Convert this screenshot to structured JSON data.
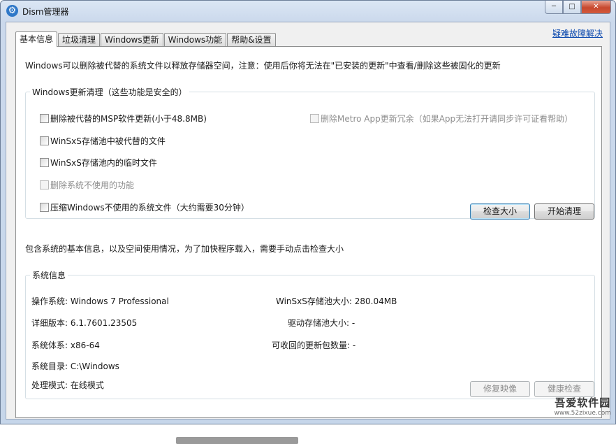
{
  "window": {
    "title": "Dism管理器",
    "buttons": {
      "minimize": "─",
      "maximize": "□",
      "close": "✕"
    }
  },
  "tabs": [
    {
      "label": "基本信息",
      "active": true
    },
    {
      "label": "垃圾清理",
      "active": false
    },
    {
      "label": "Windows更新",
      "active": false
    },
    {
      "label": "Windows功能",
      "active": false
    },
    {
      "label": "帮助&设置",
      "active": false
    }
  ],
  "help_link": "疑难故障解决",
  "notice": "Windows可以删除被代替的系统文件以释放存储器空间，注意：使用后你将无法在\"已安装的更新\"中查看/删除这些被固化的更新",
  "update_cleanup": {
    "title": "Windows更新清理（这些功能是安全的）",
    "options": [
      {
        "label": "删除被代替的MSP软件更新(小于48.8MB)",
        "checked": false,
        "enabled": true
      },
      {
        "label": "WinSxS存储池中被代替的文件",
        "checked": false,
        "enabled": true
      },
      {
        "label": "WinSxS存储池内的临时文件",
        "checked": false,
        "enabled": true
      },
      {
        "label": "删除系统不使用的功能",
        "checked": false,
        "enabled": false
      },
      {
        "label": "压缩Windows不使用的系统文件（大约需要30分钟）",
        "checked": false,
        "enabled": true
      }
    ],
    "metro_option": {
      "label": "删除Metro App更新冗余（如果App无法打开请同步许可证看帮助）",
      "checked": false,
      "enabled": false
    },
    "check_size_button": "检查大小",
    "start_clean_button": "开始清理"
  },
  "info_notice": "包含系统的基本信息，以及空间使用情况，为了加快程序载入，需要手动点击检查大小",
  "system_info": {
    "title": "系统信息",
    "os_label": "操作系统:",
    "os_value": "Windows 7 Professional",
    "version_label": "详细版本:",
    "version_value": "6.1.7601.23505",
    "arch_label": "系统体系:",
    "arch_value": "x86-64",
    "dir_label": "系统目录:",
    "dir_value": "C:\\Windows",
    "mode_label": "处理模式:",
    "mode_value": "在线模式",
    "winsxs_label": "WinSxS存储池大小:",
    "winsxs_value": "280.04MB",
    "driver_label": "驱动存储池大小:",
    "driver_value": "-",
    "recoverable_label": "可收回的更新包数量:",
    "recoverable_value": "-",
    "repair_button": "修复映像",
    "health_button": "健康检查"
  },
  "watermark": {
    "title": "吾爱软件园",
    "url": "www.52zixue.com"
  }
}
